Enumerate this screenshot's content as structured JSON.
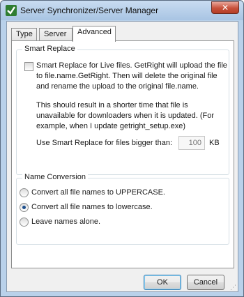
{
  "window": {
    "title": "Server Synchronizer/Server Manager",
    "close_label": "✕"
  },
  "tabs": [
    {
      "label": "Type",
      "active": false
    },
    {
      "label": "Server",
      "active": false
    },
    {
      "label": "Advanced",
      "active": true
    }
  ],
  "smart_replace": {
    "group_title": "Smart Replace",
    "checkbox_checked": false,
    "checkbox_text": "Smart Replace for Live files.  GetRight will upload the file to file.name.GetRight.  Then will delete the original file and rename the upload to the original file.name.",
    "info_text": "This should result in a shorter time that file is unavailable for downloaders when it is updated.  (For example, when I update getright_setup.exe)",
    "size_label": "Use Smart Replace for files bigger than:",
    "size_value": "100",
    "size_unit": "KB"
  },
  "name_conversion": {
    "group_title": "Name Conversion",
    "options": [
      {
        "label": "Convert all file names to UPPERCASE.",
        "checked": false
      },
      {
        "label": "Convert all file names to lowercase.",
        "checked": true
      },
      {
        "label": "Leave names alone.",
        "checked": false
      }
    ]
  },
  "buttons": {
    "ok": "OK",
    "cancel": "Cancel"
  },
  "colors": {
    "frame": "#b9d1ea",
    "client": "#f0f0f0",
    "panel": "#ffffff",
    "close_button": "#c7503a"
  }
}
